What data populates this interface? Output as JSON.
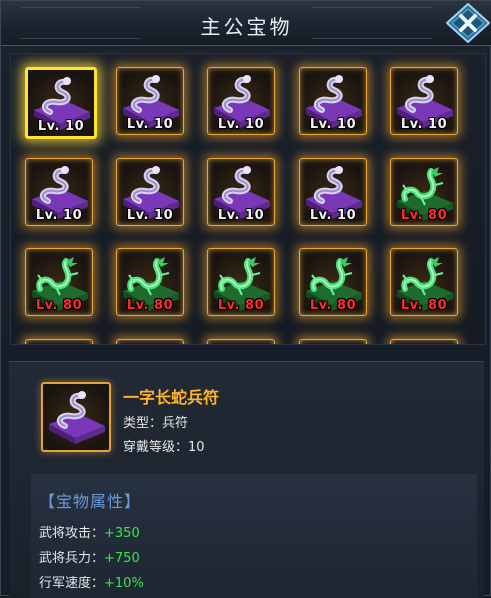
{
  "window": {
    "title": "主公宝物"
  },
  "items": [
    {
      "type": "snake",
      "level": "Lv. 10",
      "selected": true
    },
    {
      "type": "snake",
      "level": "Lv. 10"
    },
    {
      "type": "snake",
      "level": "Lv. 10"
    },
    {
      "type": "snake",
      "level": "Lv. 10"
    },
    {
      "type": "snake",
      "level": "Lv. 10"
    },
    {
      "type": "snake",
      "level": "Lv. 10"
    },
    {
      "type": "snake",
      "level": "Lv. 10"
    },
    {
      "type": "snake",
      "level": "Lv. 10"
    },
    {
      "type": "snake",
      "level": "Lv. 10"
    },
    {
      "type": "dragon",
      "level": "Lv. 80"
    },
    {
      "type": "dragon",
      "level": "Lv. 80"
    },
    {
      "type": "dragon",
      "level": "Lv. 80"
    },
    {
      "type": "dragon",
      "level": "Lv. 80"
    },
    {
      "type": "dragon",
      "level": "Lv. 80"
    },
    {
      "type": "dragon",
      "level": "Lv. 80"
    }
  ],
  "detail": {
    "name": "一字长蛇兵符",
    "type_label": "类型：",
    "type_value": "兵符",
    "equip_label": "穿戴等级：",
    "equip_value": "10",
    "attr_title": "【宝物属性】",
    "attrs": [
      {
        "label": "武将攻击：",
        "value": "+350"
      },
      {
        "label": "武将兵力：",
        "value": "+750"
      },
      {
        "label": "行军速度：",
        "value": "+10%"
      }
    ]
  },
  "colors": {
    "level_white": "#f2f2f2",
    "level_red": "#ff2b2b",
    "name": "#ffb42a",
    "attr_value": "#38e64a",
    "attr_title": "#6a9ad8"
  }
}
